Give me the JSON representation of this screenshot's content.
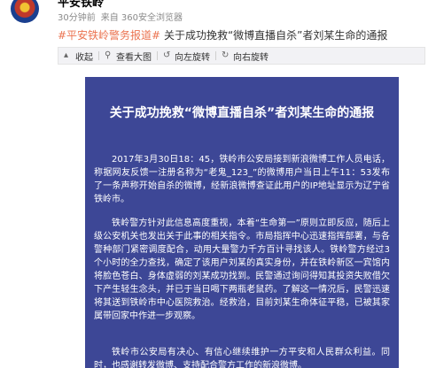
{
  "header": {
    "user_name": "平安铁岭",
    "time_ago": "30分钟前",
    "source": "来自 360安全浏览器"
  },
  "post": {
    "tag": "#平安铁岭警务报道#",
    "title": "关于成功挽救“微博直播自杀”者刘某生命的通报"
  },
  "toolbar": {
    "collapse": "收起",
    "view_large": "查看大图",
    "rotate_left": "向左旋转",
    "rotate_right": "向右旋转"
  },
  "notice": {
    "title": "关于成功挽救“微博直播自杀”者刘某生命的通报",
    "paragraph1": "2017年3月30日18：45，铁岭市公安局接到新浪微博工作人员电话，称据网友反馈一注册名称为“老鬼_123_”的微博用户当日上午11：53发布了一条声称开始自杀的微博，经新浪微博查证此用户的IP地址显示为辽宁省铁岭市。",
    "paragraph2": "铁岭警方针对此信息高度重视，本着“生命第一”原则立即反应，随后上级公安机关也发出关于此事的相关指令。市局指挥中心迅速指挥部署，与各警种部门紧密调度配合，动用大量警力千方百计寻找该人。铁岭警方经过3个小时的全力查找，确定了该用户刘某的真实身份，并在铁岭新区一宾馆内将脸色苍白、身体虚弱的刘某成功找到。民警通过询问得知其投资失败借欠下产生轻生念头，并已于当日喝下两瓶老鼠药。了解这一情况后，民警迅速将其送到铁岭市中心医院救治。经救治，目前刘某生命体征平稳，已被其家属带回家中作进一步观察。",
    "paragraph3": "铁岭市公安局有决心、有信心继续维护一方平安和人民群众利益。同时，也感谢转发微博、支持配合警方工作的新浪微博。"
  },
  "colors": {
    "notice_background": "#3d4796",
    "tag_color": "#eb7350",
    "meta_color": "#8a8a8a"
  }
}
